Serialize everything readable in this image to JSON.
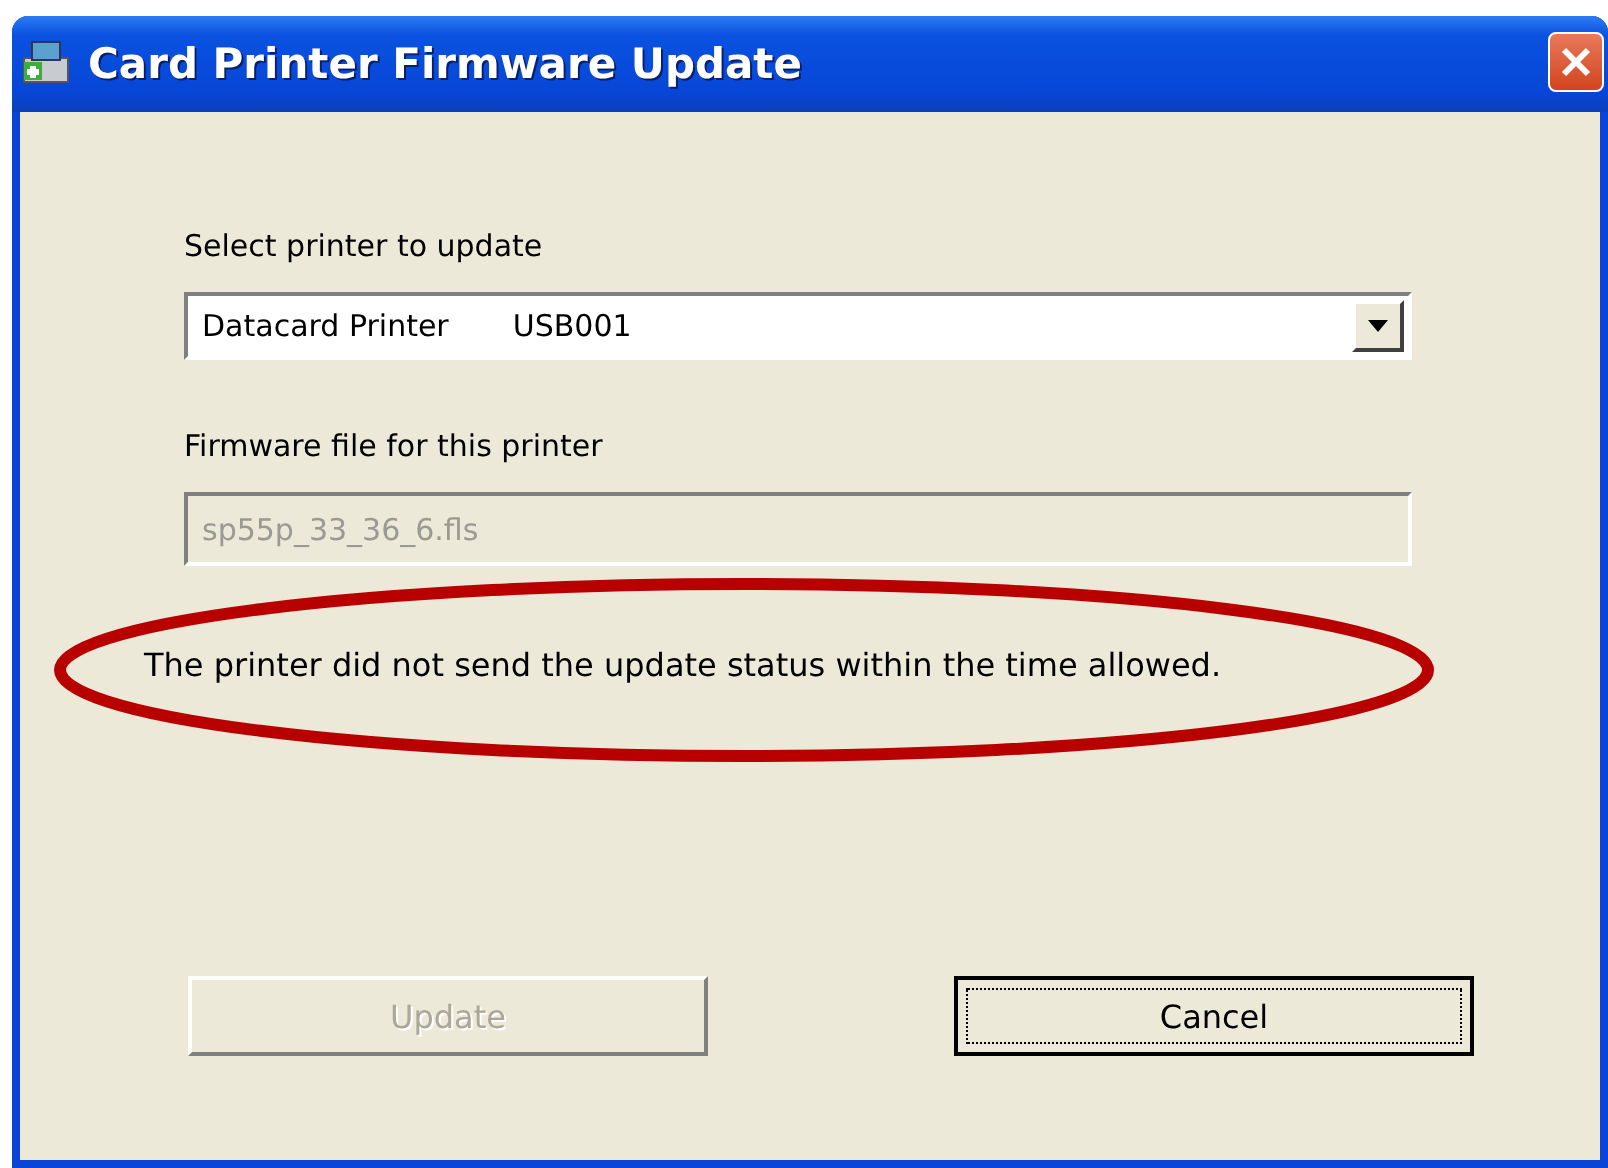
{
  "window": {
    "title": "Card Printer Firmware Update"
  },
  "printer_select": {
    "label": "Select printer to update",
    "printer": "Datacard Printer",
    "port": "USB001"
  },
  "firmware_file": {
    "label": "Firmware file for this printer",
    "value": "sp55p_33_36_6.fls",
    "disabled": true
  },
  "message": "The printer did not send the update status within the time allowed.",
  "buttons": [
    {
      "label": "Update",
      "disabled": true,
      "focused": false
    },
    {
      "label": "Cancel",
      "disabled": false,
      "focused": true
    }
  ]
}
